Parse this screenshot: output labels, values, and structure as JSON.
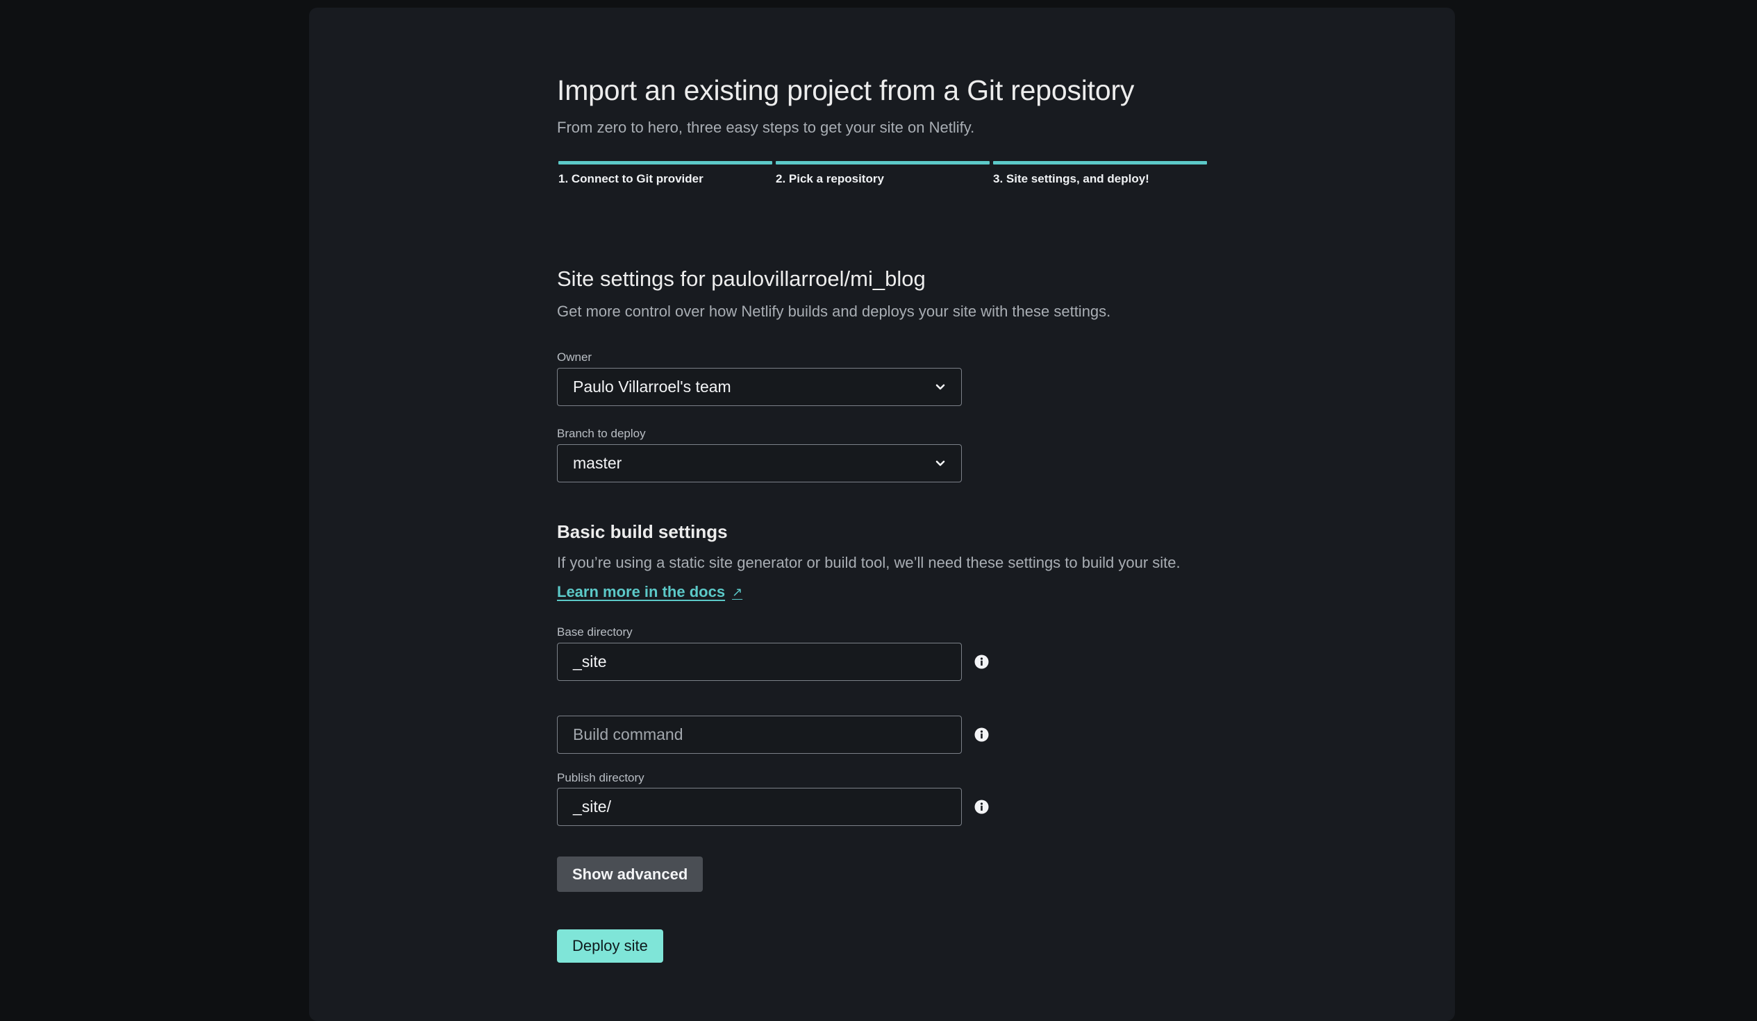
{
  "header": {
    "title": "Import an existing project from a Git repository",
    "subtitle": "From zero to hero, three easy steps to get your site on Netlify."
  },
  "steps": [
    {
      "label": "1. Connect to Git provider"
    },
    {
      "label": "2. Pick a repository"
    },
    {
      "label": "3. Site settings, and deploy!"
    }
  ],
  "site_settings": {
    "title": "Site settings for paulovillarroel/mi_blog",
    "description": "Get more control over how Netlify builds and deploys your site with these settings.",
    "owner": {
      "label": "Owner",
      "value": "Paulo Villarroel's team"
    },
    "branch": {
      "label": "Branch to deploy",
      "value": "master"
    }
  },
  "build_settings": {
    "title": "Basic build settings",
    "description": "If you’re using a static site generator or build tool, we’ll need these settings to build your site.",
    "docs_link": "Learn more in the docs",
    "docs_link_icon": "↗",
    "base_directory": {
      "label": "Base directory",
      "value": "_site"
    },
    "build_command": {
      "label": "",
      "placeholder": "Build command",
      "value": ""
    },
    "publish_directory": {
      "label": "Publish directory",
      "value": "_site/"
    }
  },
  "actions": {
    "show_advanced": "Show advanced",
    "deploy": "Deploy site"
  },
  "colors": {
    "accent": "#5cc9c8",
    "primary_button": "#7fe5d8",
    "secondary_button": "#4a4e54",
    "card_background": "#181b20",
    "page_background": "#0e1012"
  }
}
